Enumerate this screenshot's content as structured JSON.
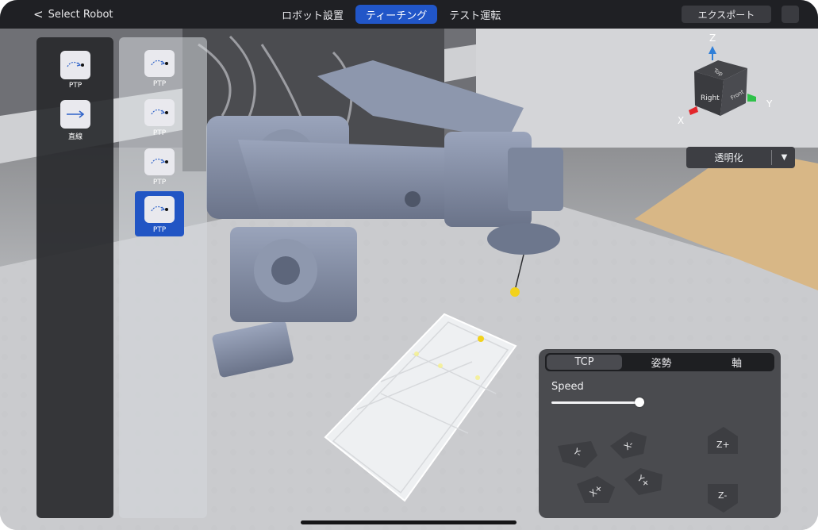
{
  "header": {
    "back_label": "Select Robot",
    "tabs": [
      {
        "label": "ロボット設置",
        "active": false
      },
      {
        "label": "ティーチング",
        "active": true
      },
      {
        "label": "テスト運転",
        "active": false
      }
    ],
    "export_label": "エクスポート"
  },
  "palette": {
    "items": [
      {
        "label": "PTP",
        "icon": "ptp-motion-icon"
      },
      {
        "label": "直線",
        "icon": "linear-arrow-icon"
      }
    ]
  },
  "sequence": {
    "items": [
      {
        "label": "PTP",
        "selected": false
      },
      {
        "label": "PTP",
        "selected": false
      },
      {
        "label": "PTP",
        "selected": false
      },
      {
        "label": "PTP",
        "selected": true
      }
    ]
  },
  "gizmo": {
    "axis_z": "Z",
    "axis_y": "Y",
    "axis_x": "X",
    "face_top": "Top",
    "face_right": "Right",
    "face_front": "Front"
  },
  "view": {
    "dropdown_label": "透明化"
  },
  "control_panel": {
    "segments": [
      {
        "label": "TCP",
        "active": true
      },
      {
        "label": "姿勢",
        "active": false
      },
      {
        "label": "軸",
        "active": false
      }
    ],
    "speed_label": "Speed",
    "speed_value": 0.95,
    "jog": {
      "y_minus": "Y-",
      "x_minus": "X-",
      "x_plus": "X+",
      "y_plus": "Y+",
      "z_plus": "Z+",
      "z_minus": "Z-"
    }
  },
  "colors": {
    "accent": "#2156C8",
    "target_marker": "#F2D21C",
    "axis_x": "#E3262B",
    "axis_y": "#2FC14A",
    "axis_z": "#2F7FD8"
  }
}
